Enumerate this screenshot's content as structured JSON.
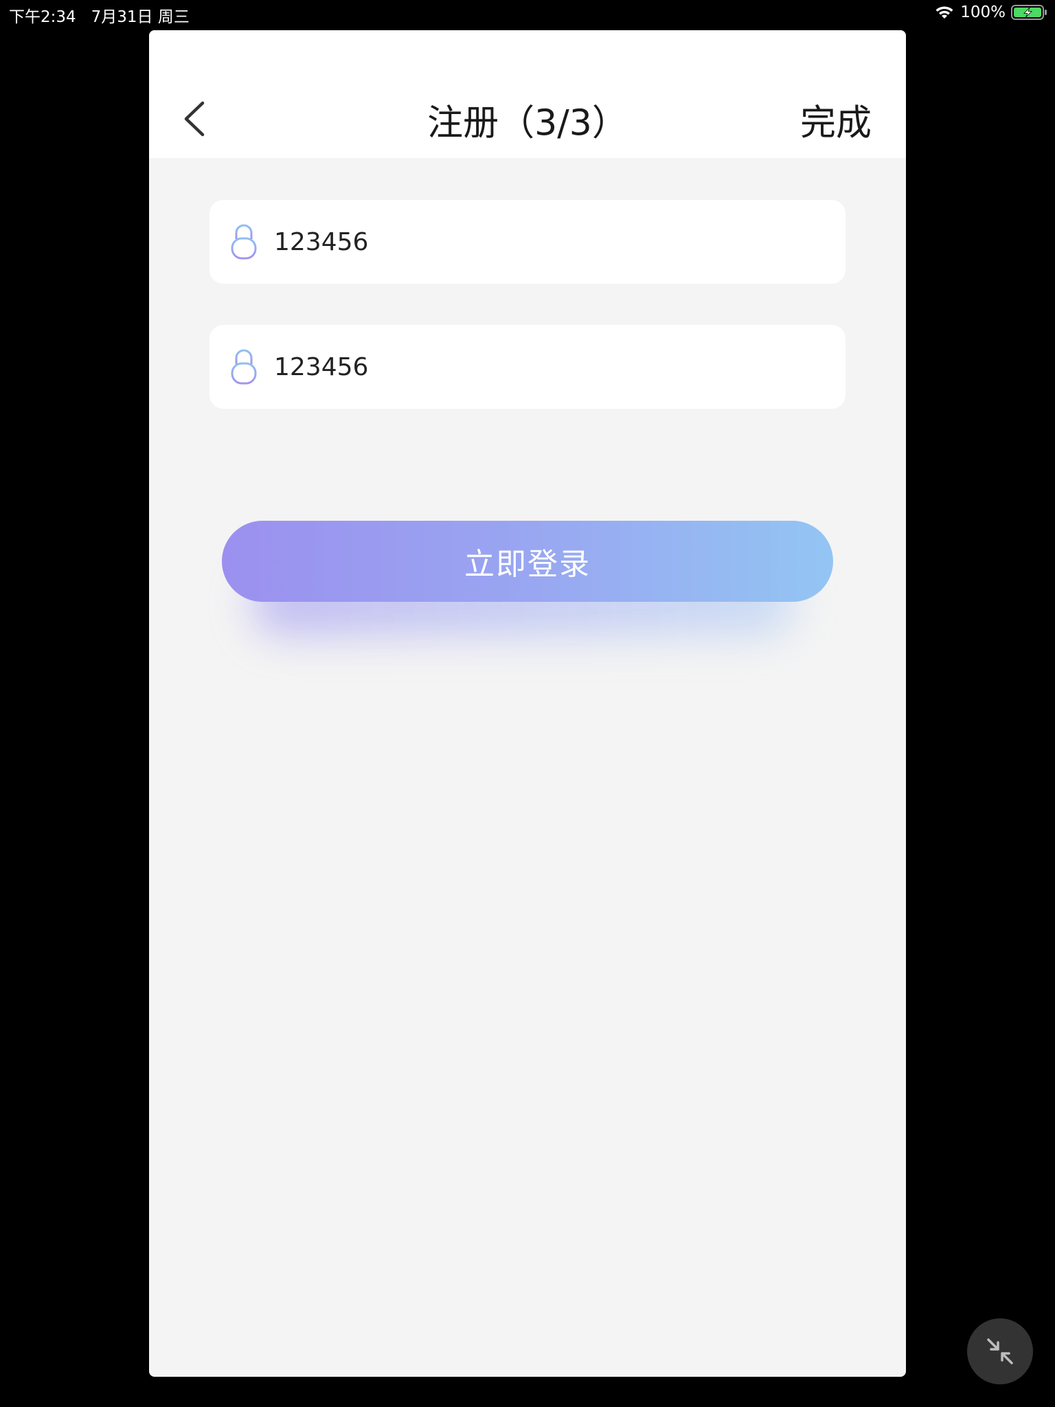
{
  "status_bar": {
    "time": "下午2:34",
    "date": "7月31日 周三",
    "battery_percent": "100%",
    "wifi_icon": "wifi-icon",
    "battery_icon": "battery-charging-icon",
    "battery_level": 1.0
  },
  "nav": {
    "back_icon": "chevron-left-icon",
    "title": "注册（3/3）",
    "done_label": "完成"
  },
  "form": {
    "password": {
      "icon": "lock-icon",
      "value": "123456"
    },
    "confirm_password": {
      "icon": "lock-icon",
      "value": "123456"
    },
    "login_button_label": "立即登录"
  },
  "floating": {
    "collapse_icon": "collapse-arrows-icon"
  },
  "colors": {
    "window_background": "#f4f4f4",
    "gradient_start": "#9b90ef",
    "gradient_end": "#93c5f3",
    "battery_green": "#4cd964"
  }
}
